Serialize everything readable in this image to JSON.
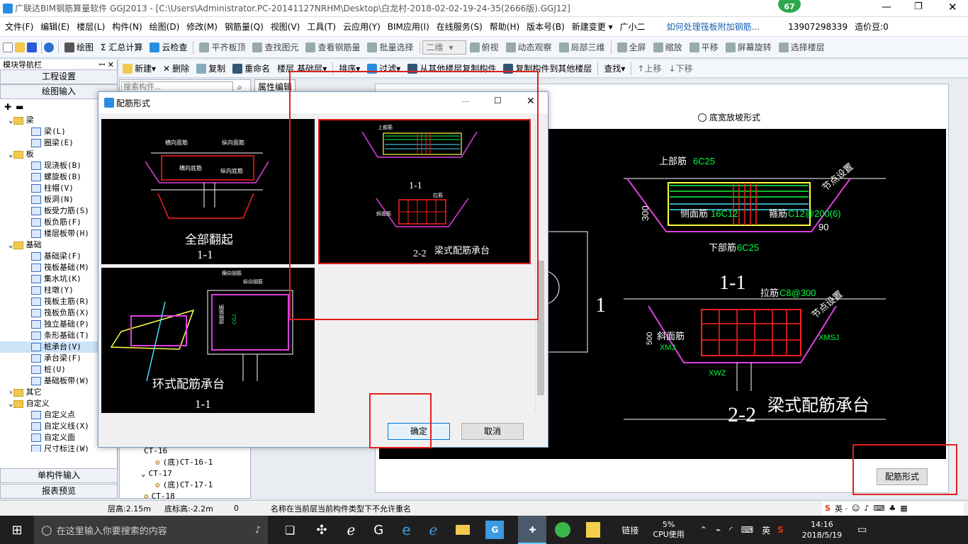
{
  "app": {
    "title": "广联达BIM钢筋算量软件 GGJ2013 - [C:\\Users\\Administrator.PC-20141127NRHM\\Desktop\\白龙村-2018-02-02-19-24-35(2666版).GGJ12]",
    "badge": "67"
  },
  "menu": [
    "文件(F)",
    "编辑(E)",
    "楼层(L)",
    "构件(N)",
    "绘图(D)",
    "修改(M)",
    "钢筋量(Q)",
    "视图(V)",
    "工具(T)",
    "云应用(Y)",
    "BIM应用(I)",
    "在线服务(S)",
    "帮助(H)",
    "版本号(B)",
    "新建变更 ▾",
    "广小二"
  ],
  "menu_right": {
    "link": "如何处理筏板附加钢筋...",
    "phone": "13907298339",
    "price": "造价豆:0"
  },
  "toolbar1": [
    "绘图",
    "Σ 汇总计算",
    "云检查",
    "平齐板顶",
    "查找图元",
    "查看钢筋量",
    "批量选择",
    "二维",
    "俯视",
    "动态观察",
    "局部三维",
    "全屏",
    "缩放",
    "平移",
    "屏幕旋转",
    "选择楼层"
  ],
  "toolbar2": [
    "新建",
    "删除",
    "复制",
    "重命名",
    "楼层",
    "基础层",
    "排序",
    "过滤",
    "从其他楼层复制构件",
    "复制构件到其他楼层",
    "查找",
    "上移",
    "下移"
  ],
  "nav": {
    "title": "模块导航栏",
    "project": "工程设置",
    "draw": "绘图输入",
    "single": "单构件输入",
    "report": "报表预览"
  },
  "tree": [
    {
      "t": "grp",
      "label": "梁"
    },
    {
      "t": "itm",
      "label": "梁(L)"
    },
    {
      "t": "itm",
      "label": "圈梁(E)"
    },
    {
      "t": "grp",
      "label": "板"
    },
    {
      "t": "itm",
      "label": "现浇板(B)"
    },
    {
      "t": "itm",
      "label": "螺旋板(B)"
    },
    {
      "t": "itm",
      "label": "柱帽(V)"
    },
    {
      "t": "itm",
      "label": "板洞(N)"
    },
    {
      "t": "itm",
      "label": "板受力筋(S)"
    },
    {
      "t": "itm",
      "label": "板负筋(F)"
    },
    {
      "t": "itm",
      "label": "楼层板带(H)"
    },
    {
      "t": "grp",
      "label": "基础"
    },
    {
      "t": "itm",
      "label": "基础梁(F)"
    },
    {
      "t": "itm",
      "label": "筏板基础(M)"
    },
    {
      "t": "itm",
      "label": "集水坑(K)"
    },
    {
      "t": "itm",
      "label": "柱墩(Y)"
    },
    {
      "t": "itm",
      "label": "筏板主筋(R)"
    },
    {
      "t": "itm",
      "label": "筏板负筋(X)"
    },
    {
      "t": "itm",
      "label": "独立基础(P)"
    },
    {
      "t": "itm",
      "label": "条形基础(T)"
    },
    {
      "t": "itm",
      "label": "桩承台(V)",
      "sel": true
    },
    {
      "t": "itm",
      "label": "承台梁(F)"
    },
    {
      "t": "itm",
      "label": "桩(U)"
    },
    {
      "t": "itm",
      "label": "基础板带(W)"
    },
    {
      "t": "grp",
      "label": "其它"
    },
    {
      "t": "grp",
      "label": "自定义"
    },
    {
      "t": "itm",
      "label": "自定义点"
    },
    {
      "t": "itm",
      "label": "自定义线(X)"
    },
    {
      "t": "itm",
      "label": "自定义面"
    },
    {
      "t": "itm",
      "label": "尺寸标注(W)"
    }
  ],
  "mid": {
    "search_placeholder": "搜索构件...",
    "items": [
      "CT-16",
      "(底)CT-16-1",
      "CT-17",
      "(底)CT-17-1",
      "CT-18"
    ]
  },
  "right": {
    "tab": "属性编辑",
    "radio": "底宽放坡形式",
    "button": "配筋形式"
  },
  "cad": {
    "top": "上部筋",
    "top_v": "6C25",
    "side": "侧面筋",
    "side_v": "16C12",
    "stirrup": "箍筋",
    "stirrup_v": "C12@200(6)",
    "bottom": "下部筋",
    "bottom_v": "6C25",
    "node": "节点设置",
    "node2": "节点设置",
    "s11": "1-1",
    "tie": "拉筋",
    "tie_v": "C8@300",
    "slope": "斜面筋",
    "xmj": "XMJ",
    "xmsj": "XMSJ",
    "xwz": "XWZ",
    "s22": "2-2",
    "title": "梁式配筋承台",
    "num1": "1",
    "dim500": "500",
    "dim300": "300",
    "ang": "90"
  },
  "dialog": {
    "title": "配筋形式",
    "c1_title": "全部翻起",
    "c1_sec": "1-1",
    "c2_title": "梁式配筋承台",
    "c2_sec1": "1-1",
    "c2_sec2": "2-2",
    "c3_title": "环式配筋承台",
    "c3_sec": "1-1",
    "ok": "确定",
    "cancel": "取消",
    "c1_l1": "横向面筋",
    "c1_l2": "纵向面筋",
    "c1_l3": "横向底筋",
    "c1_l4": "纵向底筋",
    "c3_l1": "横向钢筋",
    "c3_l2": "纵向钢筋",
    "c3_l3": "侧面钢筋",
    "c2_l1": "上部筋",
    "c2_l2": "拉筋",
    "c2_l3": "斜面筋",
    "c3_l4": "CGJ"
  },
  "status": {
    "floor_h": "层高:2.15m",
    "bottom_h": "底标高:-2.2m",
    "zero": "0",
    "msg": "名称在当前层当前构件类型下不允许重名"
  },
  "taskbar": {
    "search": "在这里输入你要搜索的内容",
    "link": "链接",
    "cpu": "5%",
    "cpu_label": "CPU使用",
    "lang": "英",
    "time": "14:16",
    "date": "2018/5/19"
  },
  "colors": {
    "red_box": "#e02020",
    "magenta": "#e040e0",
    "green": "#00ff40",
    "yellow": "#ffff40",
    "cyan": "#40e0ff",
    "rebar_red": "#ff2020"
  }
}
